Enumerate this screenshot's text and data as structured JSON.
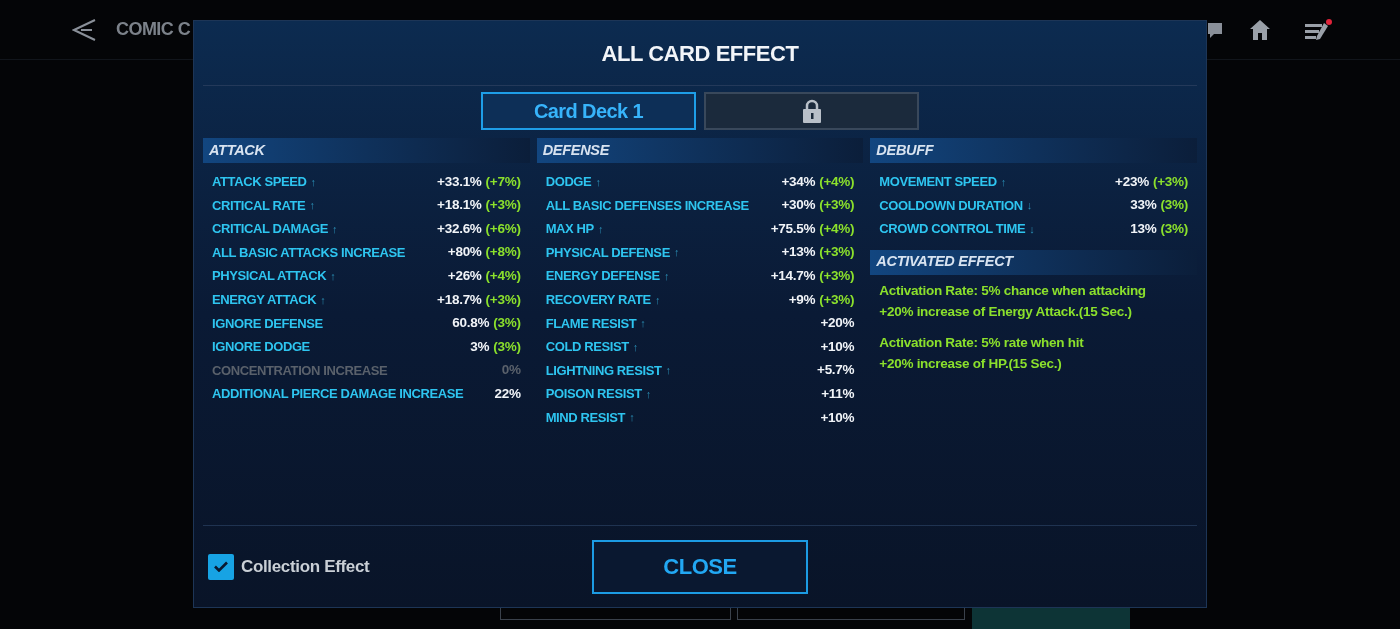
{
  "top_bar": {
    "title": "COMIC C"
  },
  "dialog": {
    "title": "ALL CARD EFFECT",
    "tabs": [
      {
        "label": "Card Deck 1",
        "selected": true,
        "locked": false
      },
      {
        "selected": false,
        "locked": true
      }
    ],
    "columns": [
      {
        "sections": [
          {
            "kind": "stats",
            "title": "ATTACK",
            "stats": [
              {
                "label": "ATTACK SPEED",
                "arrow": "↑",
                "value": "+33.1%",
                "bonus": "(+7%)",
                "disabled": false
              },
              {
                "label": "CRITICAL RATE",
                "arrow": "↑",
                "value": "+18.1%",
                "bonus": "(+3%)",
                "disabled": false
              },
              {
                "label": "CRITICAL DAMAGE",
                "arrow": "↑",
                "value": "+32.6%",
                "bonus": "(+6%)",
                "disabled": false
              },
              {
                "label": "ALL BASIC ATTACKS INCREASE",
                "value": "+80%",
                "bonus": "(+8%)",
                "disabled": false
              },
              {
                "label": "PHYSICAL ATTACK",
                "arrow": "↑",
                "value": "+26%",
                "bonus": "(+4%)",
                "disabled": false
              },
              {
                "label": "ENERGY ATTACK",
                "arrow": "↑",
                "value": "+18.7%",
                "bonus": "(+3%)",
                "disabled": false
              },
              {
                "label": "IGNORE DEFENSE",
                "value": "60.8%",
                "bonus": "(3%)",
                "disabled": false
              },
              {
                "label": "IGNORE DODGE",
                "value": "3%",
                "bonus": "(3%)",
                "disabled": false
              },
              {
                "label": "CONCENTRATION INCREASE",
                "value": "0%",
                "disabled": true
              },
              {
                "label": "ADDITIONAL PIERCE DAMAGE INCREASE",
                "value": "22%",
                "disabled": false
              }
            ]
          }
        ]
      },
      {
        "sections": [
          {
            "kind": "stats",
            "title": "DEFENSE",
            "stats": [
              {
                "label": "DODGE",
                "arrow": "↑",
                "value": "+34%",
                "bonus": "(+4%)",
                "disabled": false
              },
              {
                "label": "ALL BASIC DEFENSES INCREASE",
                "value": "+30%",
                "bonus": "(+3%)",
                "disabled": false
              },
              {
                "label": "MAX HP",
                "arrow": "↑",
                "value": "+75.5%",
                "bonus": "(+4%)",
                "disabled": false
              },
              {
                "label": "PHYSICAL DEFENSE",
                "arrow": "↑",
                "value": "+13%",
                "bonus": "(+3%)",
                "disabled": false
              },
              {
                "label": "ENERGY DEFENSE",
                "arrow": "↑",
                "value": "+14.7%",
                "bonus": "(+3%)",
                "disabled": false
              },
              {
                "label": "RECOVERY RATE",
                "arrow": "↑",
                "value": "+9%",
                "bonus": "(+3%)",
                "disabled": false
              },
              {
                "label": "FLAME RESIST",
                "arrow": "↑",
                "value": "+20%",
                "disabled": false
              },
              {
                "label": "COLD RESIST",
                "arrow": "↑",
                "value": "+10%",
                "disabled": false
              },
              {
                "label": "LIGHTNING RESIST",
                "arrow": "↑",
                "value": "+5.7%",
                "disabled": false
              },
              {
                "label": "POISON RESIST",
                "arrow": "↑",
                "value": "+11%",
                "disabled": false
              },
              {
                "label": "MIND RESIST",
                "arrow": "↑",
                "value": "+10%",
                "disabled": false
              }
            ]
          }
        ]
      },
      {
        "sections": [
          {
            "kind": "stats",
            "title": "DEBUFF",
            "stats": [
              {
                "label": "MOVEMENT SPEED",
                "arrow": "↑",
                "value": "+23%",
                "bonus": "(+3%)",
                "disabled": false
              },
              {
                "label": "COOLDOWN DURATION",
                "arrow": "↓",
                "value": "33%",
                "bonus": "(3%)",
                "disabled": false
              },
              {
                "label": "CROWD CONTROL TIME",
                "arrow": "↓",
                "value": "13%",
                "bonus": "(3%)",
                "disabled": false
              }
            ]
          },
          {
            "kind": "effects",
            "title": "ACTIVATED EFFECT",
            "effects": [
              {
                "lines": [
                  "Activation Rate: 5% chance when attacking",
                  "+20% increase of Energy Attack.(15 Sec.)"
                ]
              },
              {
                "lines": [
                  "Activation Rate: 5% rate when hit",
                  "+20% increase of HP.(15 Sec.)"
                ]
              }
            ]
          }
        ]
      }
    ],
    "collection_effect": {
      "label": "Collection Effect",
      "checked": true
    },
    "close_button": "CLOSE"
  }
}
